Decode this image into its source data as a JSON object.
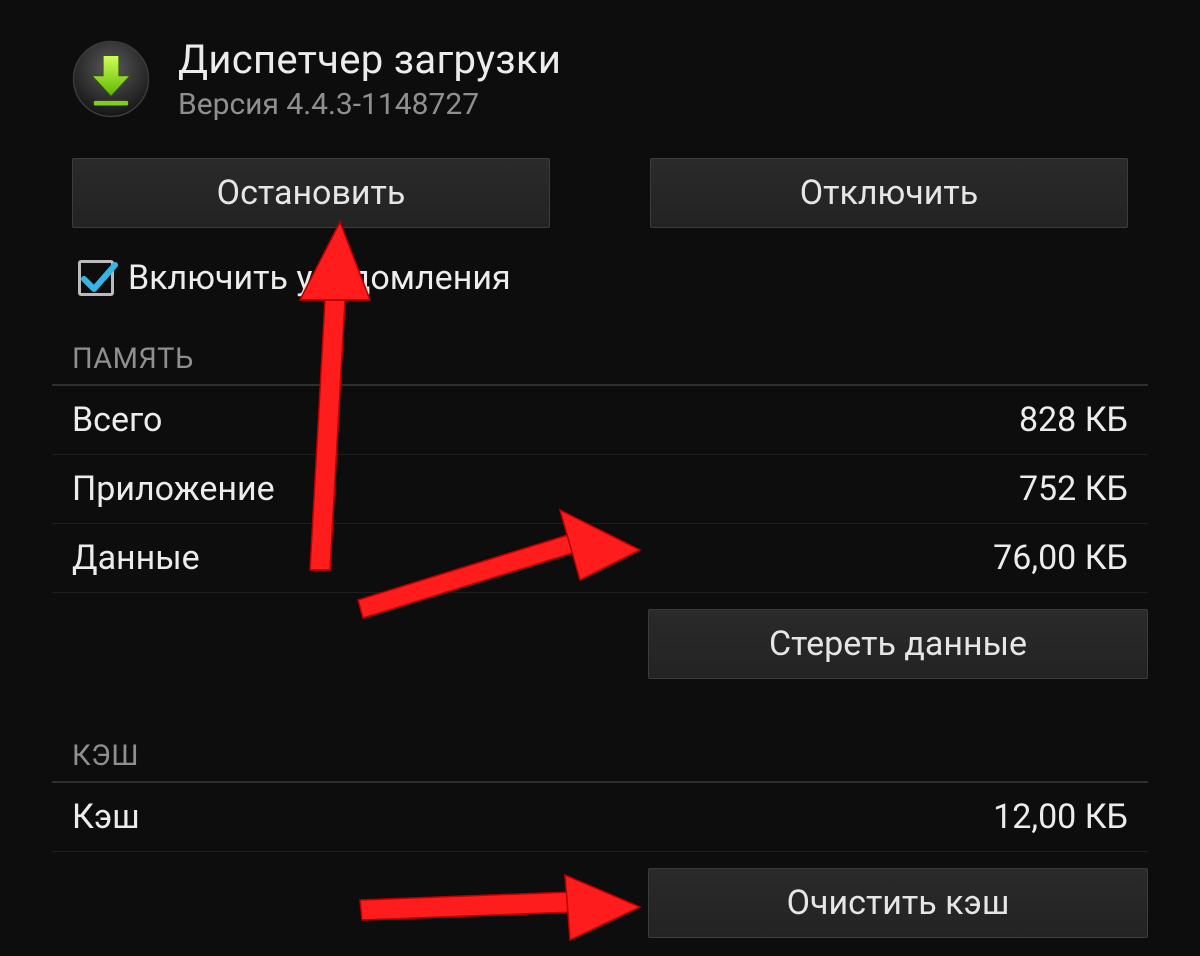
{
  "app": {
    "title": "Диспетчер загрузки",
    "version": "Версия 4.4.3-1148727"
  },
  "buttons": {
    "stop": "Остановить",
    "disable": "Отключить",
    "clear_data": "Стереть данные",
    "clear_cache": "Очистить кэш"
  },
  "checkbox": {
    "notifications_label": "Включить уведомления",
    "checked": true
  },
  "sections": {
    "storage": {
      "header": "ПАМЯТЬ",
      "rows": {
        "total": {
          "label": "Всего",
          "value": "828 КБ"
        },
        "app": {
          "label": "Приложение",
          "value": "752 КБ"
        },
        "data": {
          "label": "Данные",
          "value": "76,00 КБ"
        }
      }
    },
    "cache": {
      "header": "КЭШ",
      "rows": {
        "cache": {
          "label": "Кэш",
          "value": "12,00 КБ"
        }
      }
    }
  }
}
